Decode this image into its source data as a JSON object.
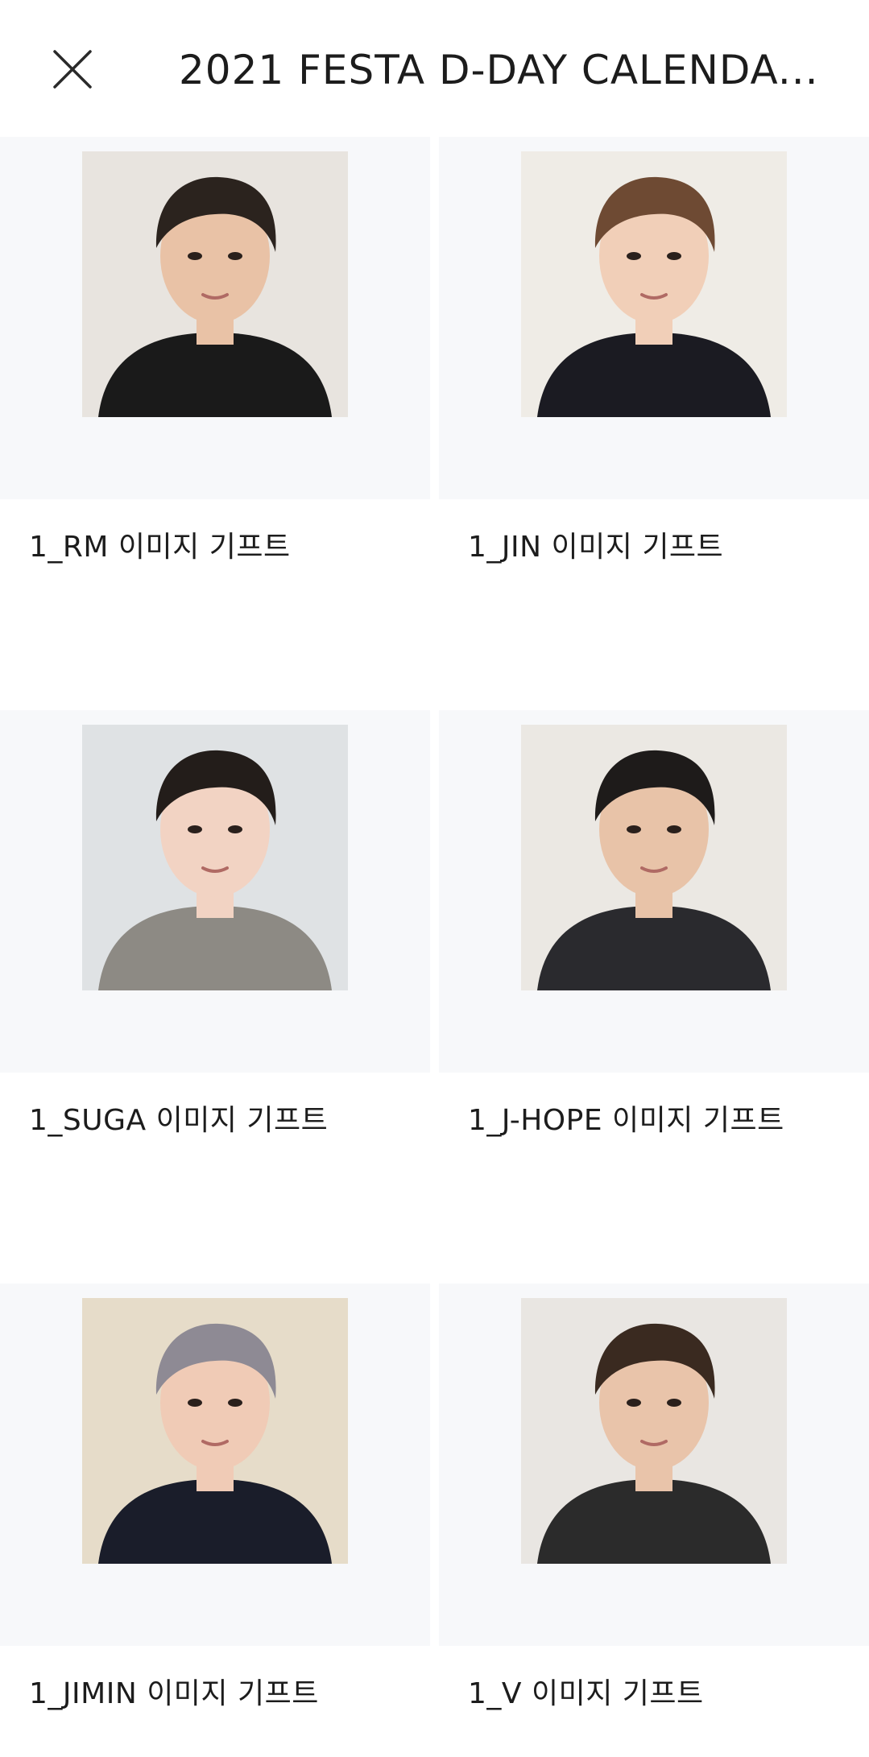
{
  "header": {
    "title": "2021 FESTA D-DAY CALENDA...",
    "close_icon": "close-icon"
  },
  "gifts": [
    {
      "label": "1_RM 이미지 기프트",
      "bg": "#e8e4df",
      "hair": "#2b231e",
      "shirt": "#1a1a1a",
      "skin": "#e9c2a6"
    },
    {
      "label": "1_JIN 이미지 기프트",
      "bg": "#efece6",
      "hair": "#6e4a33",
      "shirt": "#1b1b22",
      "skin": "#f1cfb8"
    },
    {
      "label": "1_SUGA 이미지 기프트",
      "bg": "#dfe2e4",
      "hair": "#231d1a",
      "shirt": "#8d8a84",
      "skin": "#f2d3c3"
    },
    {
      "label": "1_J-HOPE 이미지 기프트",
      "bg": "#ebe8e3",
      "hair": "#1e1b1a",
      "shirt": "#2a2a2e",
      "skin": "#e8c3a8"
    },
    {
      "label": "1_JIMIN 이미지 기프트",
      "bg": "#e6dcc9",
      "hair": "#8e8a94",
      "shirt": "#1a1d2a",
      "skin": "#f0cbb6"
    },
    {
      "label": "1_V 이미지 기프트",
      "bg": "#e9e6e2",
      "hair": "#3a2a20",
      "shirt": "#2b2b2b",
      "skin": "#e9c4aa"
    }
  ]
}
